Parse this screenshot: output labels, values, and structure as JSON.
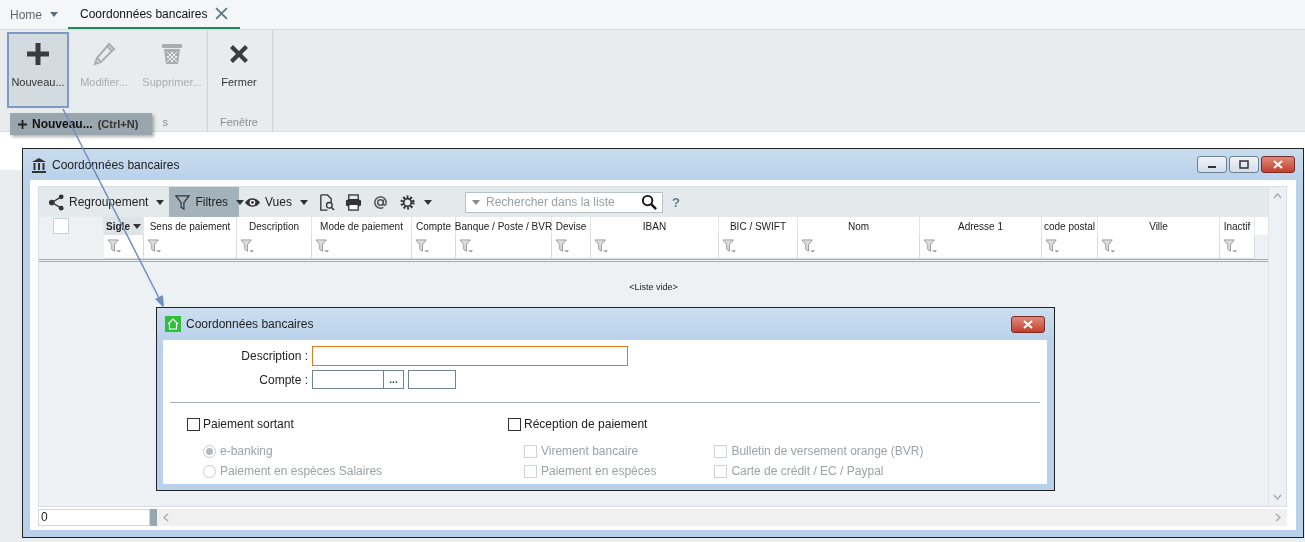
{
  "tabs": [
    {
      "label": "Home",
      "kind": "menu",
      "selected": false
    },
    {
      "label": "Coordonnées bancaires",
      "kind": "document",
      "selected": true
    }
  ],
  "ribbon": {
    "groups": [
      {
        "label": "s",
        "buttons": [
          {
            "label": "Nouveau...",
            "kind": "plus",
            "disabled": false,
            "selected": true
          },
          {
            "label": "Modifier...",
            "kind": "pencil",
            "disabled": true,
            "selected": false
          },
          {
            "label": "Supprimer...",
            "kind": "trash",
            "disabled": true,
            "selected": false
          }
        ]
      },
      {
        "label": "Fenêtre",
        "buttons": [
          {
            "label": "Fermer",
            "kind": "close",
            "disabled": false,
            "selected": false
          }
        ]
      }
    ]
  },
  "tooltip": {
    "label": "Nouveau...",
    "shortcut": "(Ctrl+N)"
  },
  "list_window": {
    "title": "Coordonnées bancaires",
    "toolbar": [
      {
        "kind": "grouping",
        "label": "Regroupement",
        "selected": false,
        "menu": true
      },
      {
        "kind": "filter",
        "label": "Filtres",
        "selected": true,
        "menu": true
      },
      {
        "kind": "eye",
        "label": "Vues",
        "selected": false,
        "menu": true
      },
      {
        "kind": "preview",
        "selected": false,
        "menu": false
      },
      {
        "kind": "print",
        "selected": false,
        "menu": false
      },
      {
        "kind": "email",
        "selected": false,
        "menu": false
      },
      {
        "kind": "gear",
        "selected": false,
        "menu": true
      }
    ],
    "search": {
      "placeholder": "Rechercher dans la liste"
    },
    "help": "?",
    "columns": [
      {
        "label": "Sigle",
        "sorted": true
      },
      {
        "label": "Sens de paiement",
        "sorted": false
      },
      {
        "label": "Description",
        "sorted": false
      },
      {
        "label": "Mode de paiement",
        "sorted": false
      },
      {
        "label": "Compte",
        "sorted": false
      },
      {
        "label": "Banque / Poste / BVR",
        "sorted": false
      },
      {
        "label": "Devise",
        "sorted": false
      },
      {
        "label": "IBAN",
        "sorted": false
      },
      {
        "label": "BIC / SWIFT",
        "sorted": false
      },
      {
        "label": "Nom",
        "sorted": false
      },
      {
        "label": "Adresse 1",
        "sorted": false
      },
      {
        "label": "code postal",
        "sorted": false
      },
      {
        "label": "Ville",
        "sorted": false
      },
      {
        "label": "Inactif",
        "sorted": false
      }
    ],
    "select_all": {
      "checked": false
    },
    "empty_text": "<Liste vide>",
    "count": "0"
  },
  "dialog": {
    "title": "Coordonnées bancaires",
    "description": {
      "label": "Description :",
      "focused": true
    },
    "account": {
      "label": "Compte :",
      "lookup": "..."
    },
    "sections": [
      {
        "label": "Paiement sortant",
        "checked": false,
        "options": [
          {
            "kind": "radio",
            "label": "e-banking",
            "selected": true,
            "disabled": true
          },
          {
            "kind": "radio",
            "label": "Paiement en espèces Salaires",
            "selected": false,
            "disabled": true
          }
        ]
      },
      {
        "label": "Réception de paiement",
        "checked": false,
        "options": [
          {
            "kind": "checkbox",
            "label": "Virement bancaire",
            "checked": false,
            "disabled": true
          },
          {
            "kind": "checkbox",
            "label": "Paiement en espèces",
            "checked": false,
            "disabled": true
          },
          {
            "kind": "checkbox",
            "label": "Bulletin de versement orange (BVR)",
            "checked": false,
            "disabled": true
          },
          {
            "kind": "checkbox",
            "label": "Carte de crédit / EC / Paypal",
            "checked": false,
            "disabled": true
          }
        ]
      }
    ]
  }
}
